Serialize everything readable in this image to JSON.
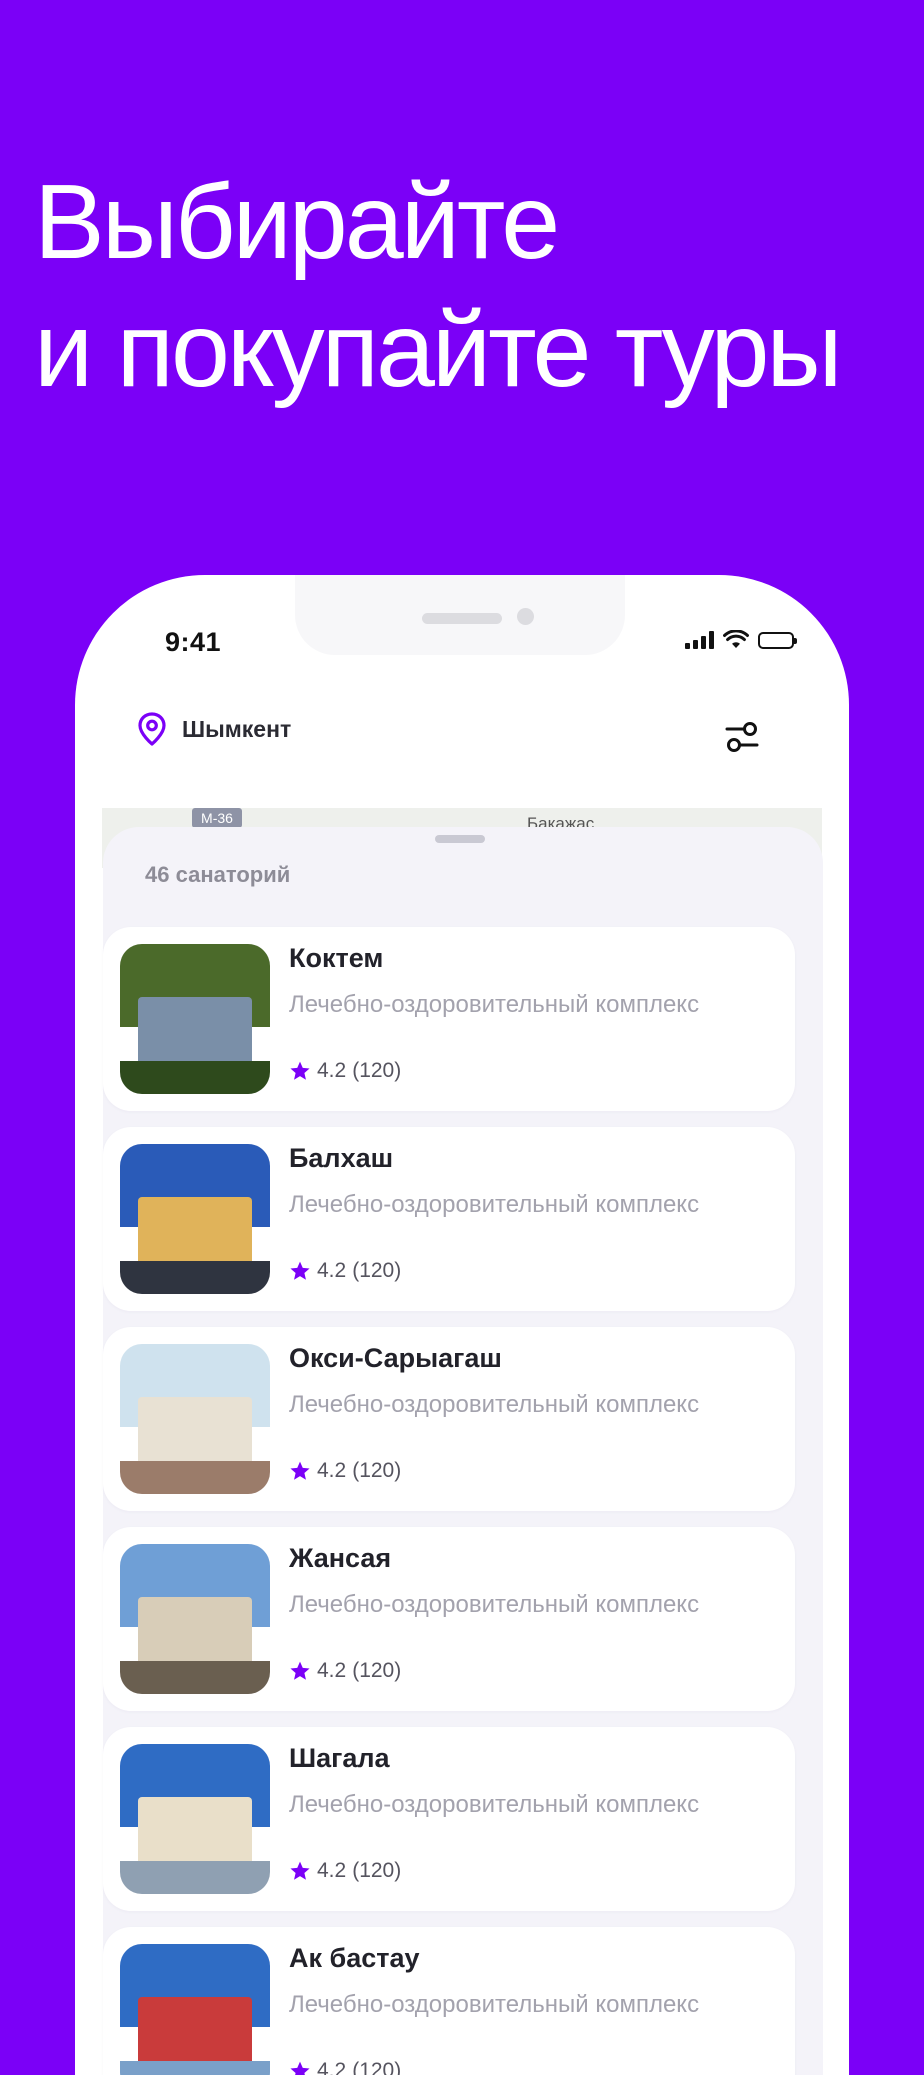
{
  "headline": {
    "line1": "Выбирайте",
    "line2": "и покупайте туры"
  },
  "status_bar": {
    "time": "9:41"
  },
  "location": {
    "city": "Шымкент"
  },
  "map": {
    "road_label": "M-36",
    "town_label": "Бакажас"
  },
  "list": {
    "count_label": "46 санаторий",
    "items": [
      {
        "title": "Коктем",
        "subtitle": "Лечебно-оздоровительный комплекс",
        "rating": "4.2",
        "reviews": "(120)",
        "palette": [
          "#4b6a2a",
          "#7a8fa8",
          "#2e4a1c"
        ]
      },
      {
        "title": "Балхаш",
        "subtitle": "Лечебно-оздоровительный комплекс",
        "rating": "4.2",
        "reviews": "(120)",
        "palette": [
          "#2a5bb8",
          "#e0b35a",
          "#2f3440"
        ]
      },
      {
        "title": "Окси-Сарыагаш",
        "subtitle": "Лечебно-оздоровительный комплекс",
        "rating": "4.2",
        "reviews": "(120)",
        "palette": [
          "#cfe2ee",
          "#e8e1d3",
          "#9b7c6a"
        ]
      },
      {
        "title": "Жансая",
        "subtitle": "Лечебно-оздоровительный комплекс",
        "rating": "4.2",
        "reviews": "(120)",
        "palette": [
          "#6f9fd6",
          "#d8cdb8",
          "#6a5f50"
        ]
      },
      {
        "title": "Шагала",
        "subtitle": "Лечебно-оздоровительный комплекс",
        "rating": "4.2",
        "reviews": "(120)",
        "palette": [
          "#2f6cc4",
          "#e9dfc9",
          "#8fa0b2"
        ]
      },
      {
        "title": "Ак бастау",
        "subtitle": "Лечебно-оздоровительный комплекс",
        "rating": "4.2",
        "reviews": "(120)",
        "palette": [
          "#2f6cc4",
          "#c93b3b",
          "#7aa0c9"
        ]
      }
    ]
  },
  "colors": {
    "brand": "#7B00F7",
    "star": "#7B00F7"
  }
}
